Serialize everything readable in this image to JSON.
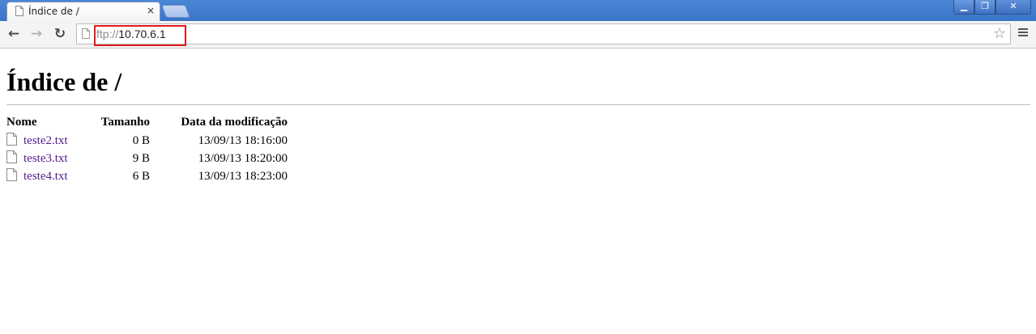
{
  "browser": {
    "tab": {
      "title": "Índice de /",
      "close": "×"
    },
    "window_controls": {
      "minimize": "▁",
      "maximize": "❐",
      "close": "✕"
    },
    "nav": {
      "back": "←",
      "forward": "→",
      "reload": "↻"
    },
    "omnibox": {
      "scheme": "ftp://",
      "host": "10.70.6.1"
    },
    "star": "☆"
  },
  "page": {
    "title": "Índice de /",
    "columns": {
      "name": "Nome",
      "size": "Tamanho",
      "date": "Data da modificação"
    },
    "files": [
      {
        "name": "teste2.txt",
        "size": "0 B",
        "modified": "13/09/13 18:16:00"
      },
      {
        "name": "teste3.txt",
        "size": "9 B",
        "modified": "13/09/13 18:20:00"
      },
      {
        "name": "teste4.txt",
        "size": "6 B",
        "modified": "13/09/13 18:23:00"
      }
    ]
  },
  "colors": {
    "titlebar": "#3a74c8",
    "visited_link": "#551a8b",
    "url_highlight": "#e01b1b"
  }
}
